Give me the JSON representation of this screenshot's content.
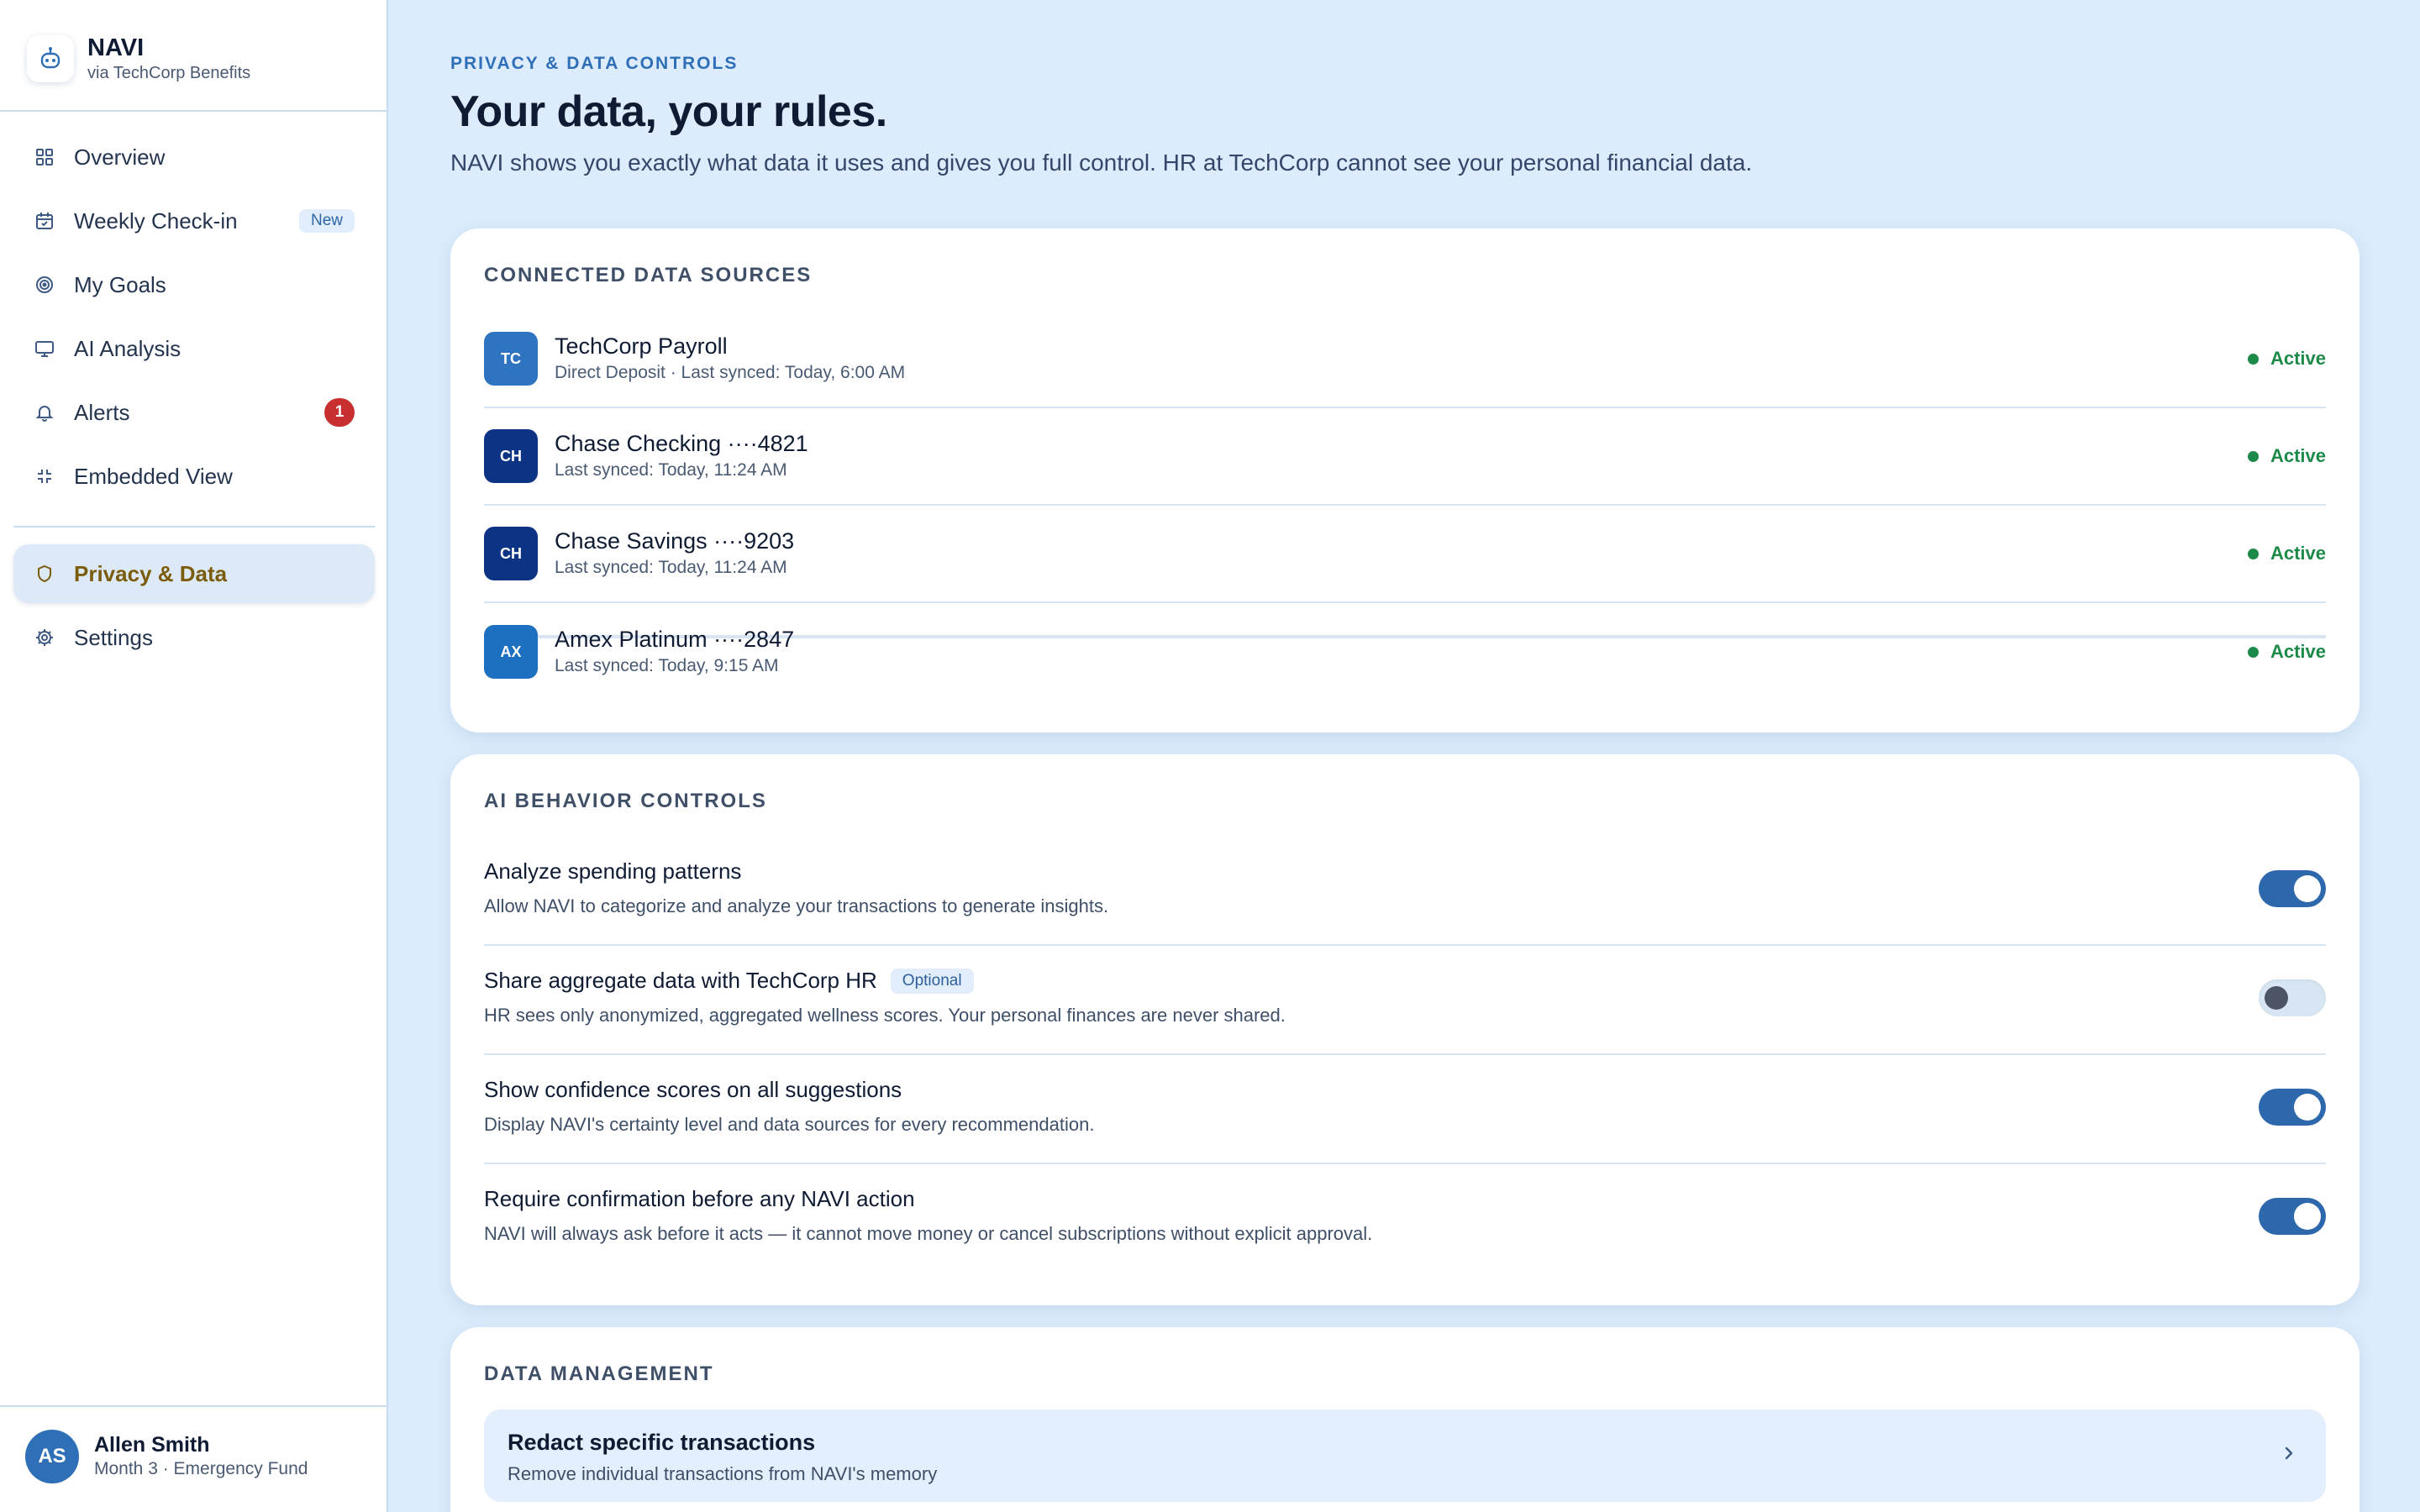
{
  "brand": {
    "name": "NAVI",
    "sub": "via TechCorp Benefits"
  },
  "nav": {
    "items": [
      {
        "label": "Overview",
        "icon": "grid-icon"
      },
      {
        "label": "Weekly Check-in",
        "icon": "calendar-icon",
        "badge": "New"
      },
      {
        "label": "My Goals",
        "icon": "target-icon"
      },
      {
        "label": "AI Analysis",
        "icon": "monitor-icon"
      },
      {
        "label": "Alerts",
        "icon": "bell-icon",
        "count": "1"
      },
      {
        "label": "Embedded View",
        "icon": "embed-icon"
      }
    ],
    "secondary": [
      {
        "label": "Privacy & Data",
        "icon": "shield-icon",
        "active": true
      },
      {
        "label": "Settings",
        "icon": "gear-icon"
      }
    ]
  },
  "user": {
    "initials": "AS",
    "name": "Allen Smith",
    "sub": "Month 3 · Emergency Fund"
  },
  "header": {
    "eyebrow": "PRIVACY & DATA CONTROLS",
    "title": "Your data, your rules.",
    "subtitle": "NAVI shows you exactly what data it uses and gives you full control. HR at TechCorp cannot see your personal financial data."
  },
  "sources": {
    "title": "CONNECTED DATA SOURCES",
    "items": [
      {
        "logo": "TC",
        "color": "#2f74c0",
        "name": "TechCorp Payroll",
        "sub": "Direct Deposit · Last synced: Today, 6:00 AM",
        "status": "Active"
      },
      {
        "logo": "CH",
        "color": "#0d3385",
        "name": "Chase Checking ····4821",
        "sub": "Last synced: Today, 11:24 AM",
        "status": "Active"
      },
      {
        "logo": "CH",
        "color": "#0d3385",
        "name": "Chase Savings ····9203",
        "sub": "Last synced: Today, 11:24 AM",
        "status": "Active"
      },
      {
        "logo": "AX",
        "color": "#1d6fbf",
        "name": "Amex Platinum ····2847",
        "sub": "Last synced: Today, 9:15 AM",
        "status": "Active"
      }
    ]
  },
  "controls": {
    "title": "AI BEHAVIOR CONTROLS",
    "items": [
      {
        "name": "Analyze spending patterns",
        "desc": "Allow NAVI to categorize and analyze your transactions to generate insights.",
        "on": true
      },
      {
        "name": "Share aggregate data with TechCorp HR",
        "tag": "Optional",
        "desc": "HR sees only anonymized, aggregated wellness scores. Your personal finances are never shared.",
        "on": false
      },
      {
        "name": "Show confidence scores on all suggestions",
        "desc": "Display NAVI's certainty level and data sources for every recommendation.",
        "on": true
      },
      {
        "name": "Require confirmation before any NAVI action",
        "desc": "NAVI will always ask before it acts — it cannot move money or cancel subscriptions without explicit approval.",
        "on": true
      }
    ]
  },
  "data_management": {
    "title": "DATA MANAGEMENT",
    "items": [
      {
        "name": "Redact specific transactions",
        "desc": "Remove individual transactions from NAVI's memory"
      }
    ]
  },
  "colors": {
    "accent": "#2e68ac",
    "active_nav_text": "#7a5c0c",
    "status_green": "#1e8a4a",
    "alert_red": "#c72f31",
    "background": "#dcecfc"
  }
}
